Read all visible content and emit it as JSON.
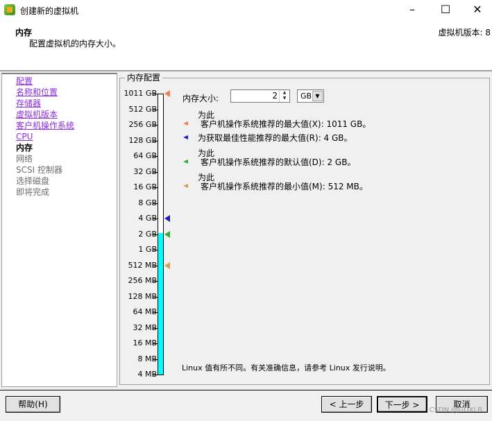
{
  "window": {
    "title": "创建新的虚拟机",
    "minimize": "–",
    "maximize": "☐",
    "close": "✕"
  },
  "header": {
    "title": "内存",
    "subtitle": "配置虚拟机的内存大小。",
    "version": "虚拟机版本: 8"
  },
  "sidebar": {
    "items": [
      {
        "label": "配置",
        "state": "link"
      },
      {
        "label": "名称和位置",
        "state": "link"
      },
      {
        "label": "存储器",
        "state": "link"
      },
      {
        "label": "虚拟机版本",
        "state": "link"
      },
      {
        "label": "客户机操作系统",
        "state": "link"
      },
      {
        "label": "CPU",
        "state": "link"
      },
      {
        "label": "内存",
        "state": "current"
      },
      {
        "label": "网络",
        "state": "disabled"
      },
      {
        "label": "SCSI 控制器",
        "state": "disabled"
      },
      {
        "label": "选择磁盘",
        "state": "disabled"
      },
      {
        "label": "即将完成",
        "state": "disabled"
      }
    ]
  },
  "memory": {
    "group_label": "内存配置",
    "size_label": "内存大小:",
    "size_value": "2",
    "unit": "GB",
    "scale": [
      "1011 GB",
      "512 GB",
      "256 GB",
      "128 GB",
      "64 GB",
      "32 GB",
      "16 GB",
      "8 GB",
      "4 GB",
      "2 GB",
      "1 GB",
      "512 MB",
      "256 MB",
      "128 MB",
      "64 MB",
      "32 MB",
      "16 MB",
      "8 MB",
      "4 MB"
    ],
    "current_index": 9,
    "markers": [
      {
        "index": 0,
        "color": "#f08050",
        "line1": "为此",
        "line2": "客户机操作系统推荐的最大值(X): 1011 GB。"
      },
      {
        "index": 8,
        "color": "#1a1ad0",
        "line1": "",
        "line2": "为获取最佳性能推荐的最大值(R): 4 GB。"
      },
      {
        "index": 9,
        "color": "#30b030",
        "line1": "为此",
        "line2": "客户机操作系统推荐的默认值(D): 2 GB。"
      },
      {
        "index": 11,
        "color": "#d0a050",
        "line1": "为此",
        "line2": "客户机操作系统推荐的最小值(M): 512 MB。"
      }
    ],
    "note": "Linux 值有所不同。有关准确信息，请参考 Linux 发行说明。"
  },
  "buttons": {
    "help": "帮助(H)",
    "back": "< 上一步",
    "next": "下一步 >",
    "cancel": "取消"
  },
  "watermark": "CSDN @GDXLB"
}
